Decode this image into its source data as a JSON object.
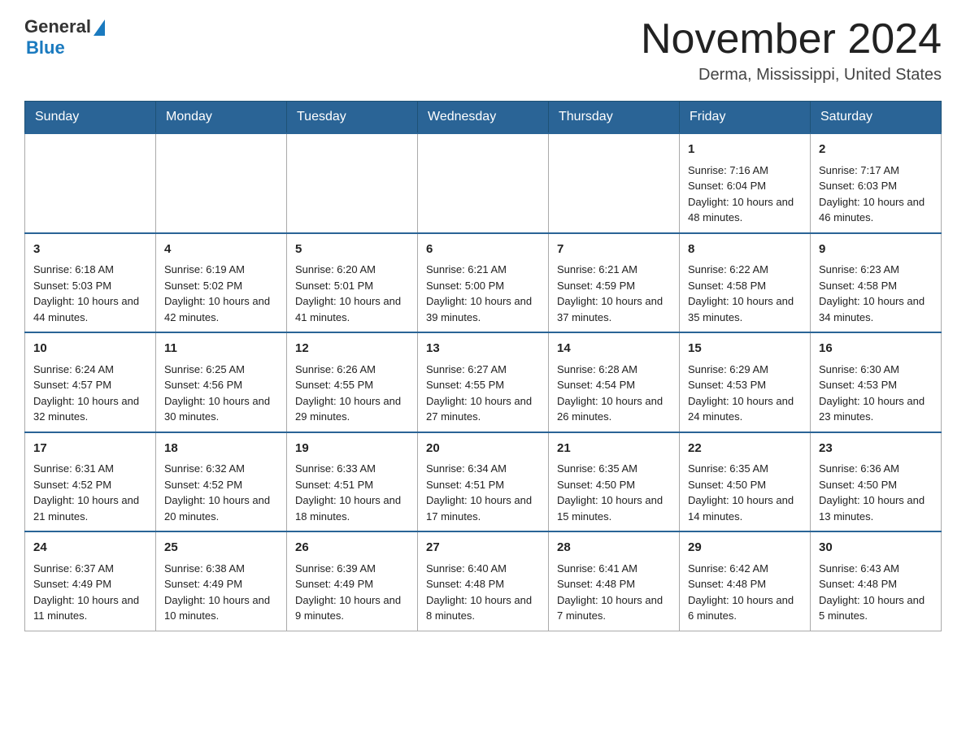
{
  "header": {
    "logo_general": "General",
    "logo_blue": "Blue",
    "month_title": "November 2024",
    "location": "Derma, Mississippi, United States"
  },
  "weekdays": [
    "Sunday",
    "Monday",
    "Tuesday",
    "Wednesday",
    "Thursday",
    "Friday",
    "Saturday"
  ],
  "weeks": [
    [
      {
        "day": "",
        "sunrise": "",
        "sunset": "",
        "daylight": ""
      },
      {
        "day": "",
        "sunrise": "",
        "sunset": "",
        "daylight": ""
      },
      {
        "day": "",
        "sunrise": "",
        "sunset": "",
        "daylight": ""
      },
      {
        "day": "",
        "sunrise": "",
        "sunset": "",
        "daylight": ""
      },
      {
        "day": "",
        "sunrise": "",
        "sunset": "",
        "daylight": ""
      },
      {
        "day": "1",
        "sunrise": "Sunrise: 7:16 AM",
        "sunset": "Sunset: 6:04 PM",
        "daylight": "Daylight: 10 hours and 48 minutes."
      },
      {
        "day": "2",
        "sunrise": "Sunrise: 7:17 AM",
        "sunset": "Sunset: 6:03 PM",
        "daylight": "Daylight: 10 hours and 46 minutes."
      }
    ],
    [
      {
        "day": "3",
        "sunrise": "Sunrise: 6:18 AM",
        "sunset": "Sunset: 5:03 PM",
        "daylight": "Daylight: 10 hours and 44 minutes."
      },
      {
        "day": "4",
        "sunrise": "Sunrise: 6:19 AM",
        "sunset": "Sunset: 5:02 PM",
        "daylight": "Daylight: 10 hours and 42 minutes."
      },
      {
        "day": "5",
        "sunrise": "Sunrise: 6:20 AM",
        "sunset": "Sunset: 5:01 PM",
        "daylight": "Daylight: 10 hours and 41 minutes."
      },
      {
        "day": "6",
        "sunrise": "Sunrise: 6:21 AM",
        "sunset": "Sunset: 5:00 PM",
        "daylight": "Daylight: 10 hours and 39 minutes."
      },
      {
        "day": "7",
        "sunrise": "Sunrise: 6:21 AM",
        "sunset": "Sunset: 4:59 PM",
        "daylight": "Daylight: 10 hours and 37 minutes."
      },
      {
        "day": "8",
        "sunrise": "Sunrise: 6:22 AM",
        "sunset": "Sunset: 4:58 PM",
        "daylight": "Daylight: 10 hours and 35 minutes."
      },
      {
        "day": "9",
        "sunrise": "Sunrise: 6:23 AM",
        "sunset": "Sunset: 4:58 PM",
        "daylight": "Daylight: 10 hours and 34 minutes."
      }
    ],
    [
      {
        "day": "10",
        "sunrise": "Sunrise: 6:24 AM",
        "sunset": "Sunset: 4:57 PM",
        "daylight": "Daylight: 10 hours and 32 minutes."
      },
      {
        "day": "11",
        "sunrise": "Sunrise: 6:25 AM",
        "sunset": "Sunset: 4:56 PM",
        "daylight": "Daylight: 10 hours and 30 minutes."
      },
      {
        "day": "12",
        "sunrise": "Sunrise: 6:26 AM",
        "sunset": "Sunset: 4:55 PM",
        "daylight": "Daylight: 10 hours and 29 minutes."
      },
      {
        "day": "13",
        "sunrise": "Sunrise: 6:27 AM",
        "sunset": "Sunset: 4:55 PM",
        "daylight": "Daylight: 10 hours and 27 minutes."
      },
      {
        "day": "14",
        "sunrise": "Sunrise: 6:28 AM",
        "sunset": "Sunset: 4:54 PM",
        "daylight": "Daylight: 10 hours and 26 minutes."
      },
      {
        "day": "15",
        "sunrise": "Sunrise: 6:29 AM",
        "sunset": "Sunset: 4:53 PM",
        "daylight": "Daylight: 10 hours and 24 minutes."
      },
      {
        "day": "16",
        "sunrise": "Sunrise: 6:30 AM",
        "sunset": "Sunset: 4:53 PM",
        "daylight": "Daylight: 10 hours and 23 minutes."
      }
    ],
    [
      {
        "day": "17",
        "sunrise": "Sunrise: 6:31 AM",
        "sunset": "Sunset: 4:52 PM",
        "daylight": "Daylight: 10 hours and 21 minutes."
      },
      {
        "day": "18",
        "sunrise": "Sunrise: 6:32 AM",
        "sunset": "Sunset: 4:52 PM",
        "daylight": "Daylight: 10 hours and 20 minutes."
      },
      {
        "day": "19",
        "sunrise": "Sunrise: 6:33 AM",
        "sunset": "Sunset: 4:51 PM",
        "daylight": "Daylight: 10 hours and 18 minutes."
      },
      {
        "day": "20",
        "sunrise": "Sunrise: 6:34 AM",
        "sunset": "Sunset: 4:51 PM",
        "daylight": "Daylight: 10 hours and 17 minutes."
      },
      {
        "day": "21",
        "sunrise": "Sunrise: 6:35 AM",
        "sunset": "Sunset: 4:50 PM",
        "daylight": "Daylight: 10 hours and 15 minutes."
      },
      {
        "day": "22",
        "sunrise": "Sunrise: 6:35 AM",
        "sunset": "Sunset: 4:50 PM",
        "daylight": "Daylight: 10 hours and 14 minutes."
      },
      {
        "day": "23",
        "sunrise": "Sunrise: 6:36 AM",
        "sunset": "Sunset: 4:50 PM",
        "daylight": "Daylight: 10 hours and 13 minutes."
      }
    ],
    [
      {
        "day": "24",
        "sunrise": "Sunrise: 6:37 AM",
        "sunset": "Sunset: 4:49 PM",
        "daylight": "Daylight: 10 hours and 11 minutes."
      },
      {
        "day": "25",
        "sunrise": "Sunrise: 6:38 AM",
        "sunset": "Sunset: 4:49 PM",
        "daylight": "Daylight: 10 hours and 10 minutes."
      },
      {
        "day": "26",
        "sunrise": "Sunrise: 6:39 AM",
        "sunset": "Sunset: 4:49 PM",
        "daylight": "Daylight: 10 hours and 9 minutes."
      },
      {
        "day": "27",
        "sunrise": "Sunrise: 6:40 AM",
        "sunset": "Sunset: 4:48 PM",
        "daylight": "Daylight: 10 hours and 8 minutes."
      },
      {
        "day": "28",
        "sunrise": "Sunrise: 6:41 AM",
        "sunset": "Sunset: 4:48 PM",
        "daylight": "Daylight: 10 hours and 7 minutes."
      },
      {
        "day": "29",
        "sunrise": "Sunrise: 6:42 AM",
        "sunset": "Sunset: 4:48 PM",
        "daylight": "Daylight: 10 hours and 6 minutes."
      },
      {
        "day": "30",
        "sunrise": "Sunrise: 6:43 AM",
        "sunset": "Sunset: 4:48 PM",
        "daylight": "Daylight: 10 hours and 5 minutes."
      }
    ]
  ]
}
